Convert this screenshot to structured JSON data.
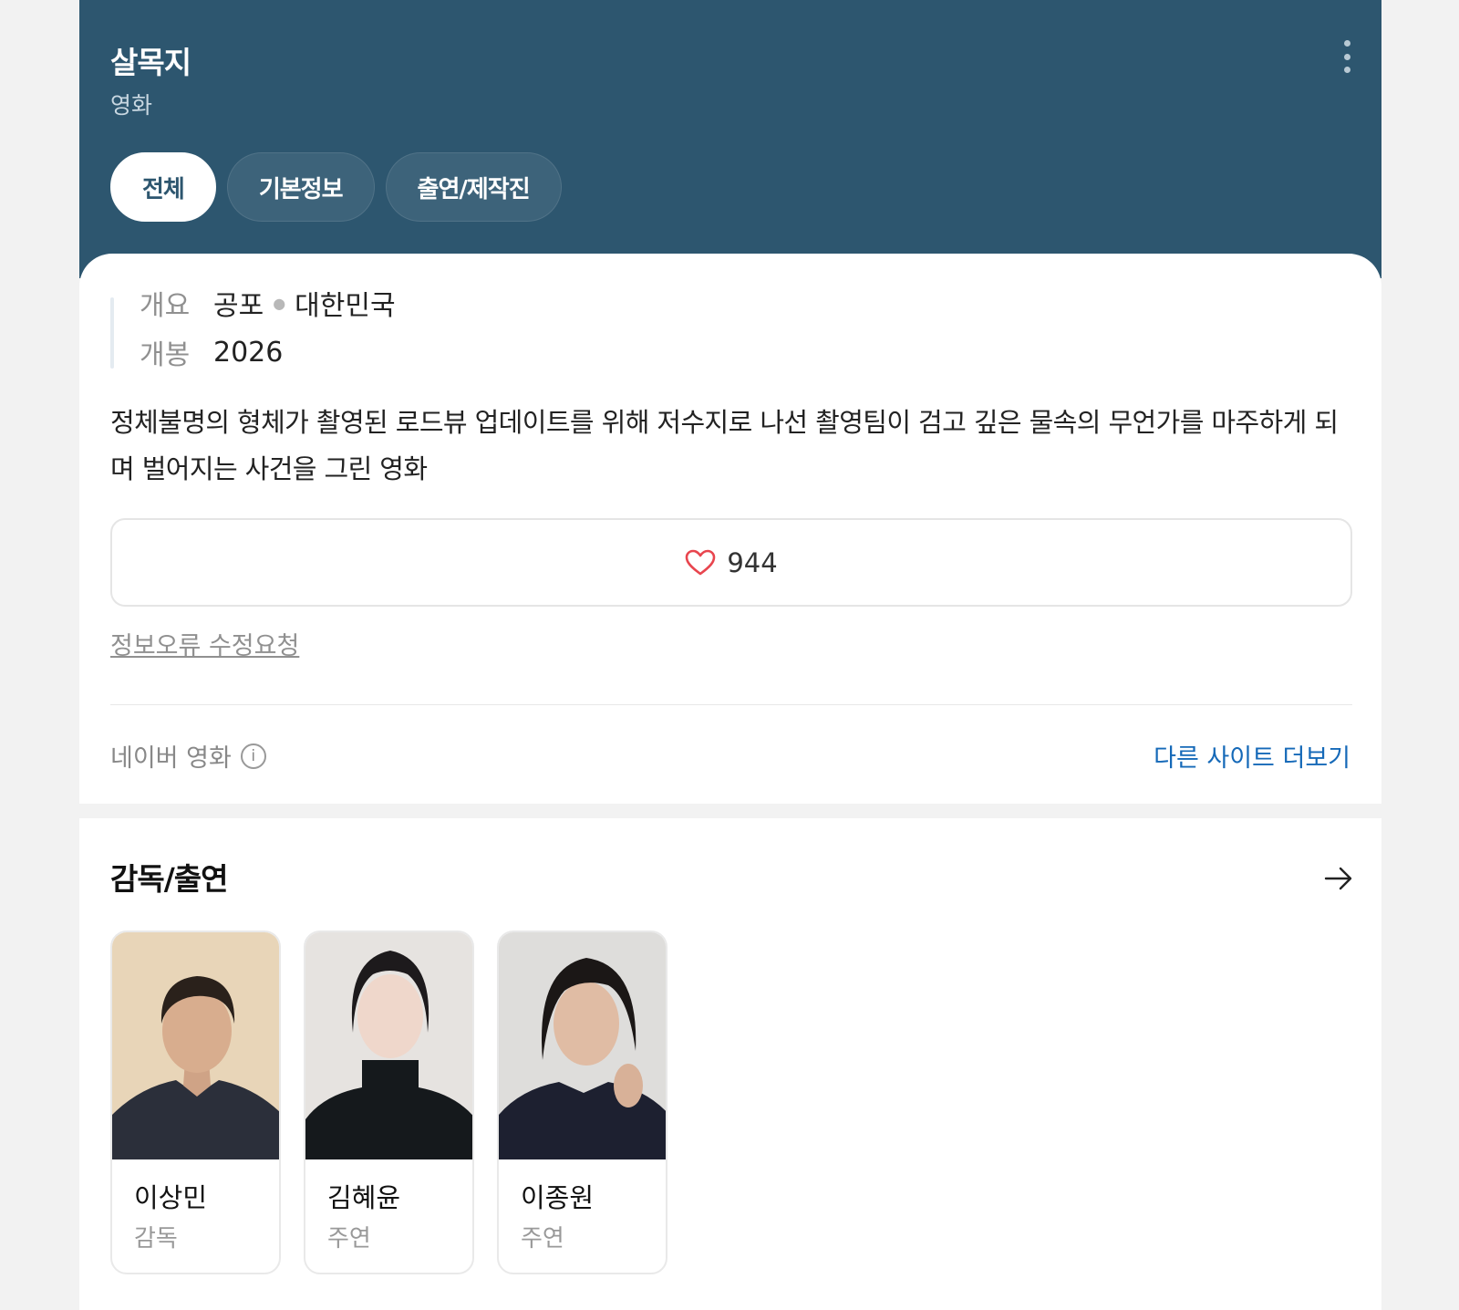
{
  "header": {
    "title": "살목지",
    "subtitle": "영화",
    "tabs": [
      {
        "label": "전체",
        "active": true
      },
      {
        "label": "기본정보",
        "active": false
      },
      {
        "label": "출연/제작진",
        "active": false
      }
    ],
    "more_icon": "vertical-ellipsis-icon"
  },
  "overview": {
    "summary_label": "개요",
    "genre": "공포",
    "country": "대한민국",
    "release_label": "개봉",
    "release_year": "2026",
    "synopsis": "정체불명의 형체가 촬영된 로드뷰 업데이트를 위해 저수지로 나선 촬영팀이 검고 깊은 물속의 무언가를 마주하게 되며 벌어지는 사건을 그린 영화",
    "like_icon": "heart-outline-icon",
    "like_count": "944",
    "report_link": "정보오류 수정요청",
    "source": "네이버 영화",
    "source_info_icon": "info-icon",
    "more_sites": "다른 사이트 더보기"
  },
  "cast": {
    "title": "감독/출연",
    "arrow_icon": "arrow-right-icon",
    "people": [
      {
        "name": "이상민",
        "role": "감독"
      },
      {
        "name": "김혜윤",
        "role": "주연"
      },
      {
        "name": "이종원",
        "role": "주연"
      }
    ]
  },
  "colors": {
    "header_bg": "#2d566f",
    "link_blue": "#1569b8",
    "heart_red": "#e8454e"
  }
}
